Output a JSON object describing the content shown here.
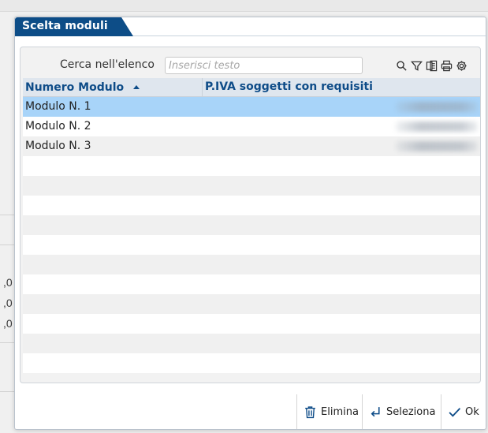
{
  "background": {
    "fragments": [
      ",0",
      ",0",
      ",0"
    ]
  },
  "dialog": {
    "title": "Scelta moduli",
    "search": {
      "label": "Cerca nell'elenco",
      "placeholder": "Inserisci testo",
      "value": ""
    },
    "toolbar_icons": [
      "search-icon",
      "filter-icon",
      "export-icon",
      "print-icon",
      "settings-icon"
    ],
    "table": {
      "columns": [
        "Numero Modulo",
        "P.IVA soggetti con requisiti"
      ],
      "sort": {
        "column": "Numero Modulo",
        "direction": "ascending"
      },
      "rows": [
        {
          "numero_modulo": "Modulo N. 1",
          "piva": "",
          "selected": true
        },
        {
          "numero_modulo": "Modulo N. 2",
          "piva": "",
          "selected": false
        },
        {
          "numero_modulo": "Modulo N. 3",
          "piva": "",
          "selected": false
        }
      ],
      "empty_rows": 11
    },
    "buttons": {
      "elimina": "Elimina",
      "seleziona": "Seleziona",
      "ok": "Ok"
    }
  },
  "colors": {
    "title_bar": "#0d4d87",
    "header_text": "#0e4c88",
    "selected_row": "#a8d4f9"
  }
}
